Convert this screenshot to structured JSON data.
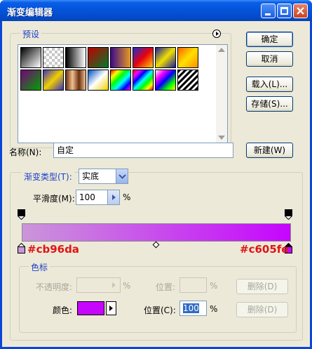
{
  "window": {
    "title": "渐变编辑器"
  },
  "presets": {
    "label": "预设",
    "swatches": [
      "linear-gradient(135deg,#000,#fff)",
      "repeating-conic-gradient(#c8c8c8 0 25%,#fff 0 50%) 0 0/8px 8px",
      "linear-gradient(to right,#000,#fff)",
      "linear-gradient(135deg,#c00000,#007a2a)",
      "linear-gradient(to right,#3b0a8c,#e89a20)",
      "linear-gradient(135deg,#1b2fd0,#e80010,#ffd000)",
      "linear-gradient(135deg,#1a1aa0,#f0e000,#1a1aa0)",
      "linear-gradient(135deg,#ff6000,#ffe000,#ff9000)",
      "linear-gradient(135deg,#7a007a,#00a000)",
      "linear-gradient(135deg,#4030c0,#f0d000,#4030c0)",
      "linear-gradient(to right,#6a3010,#f0c090,#6a3010,#f0c090)",
      "linear-gradient(135deg,#0050c0,#ffffff,#f0d000)",
      "linear-gradient(135deg,#ff0000,#ffff00,#00ff00,#00ffff,#0000ff,#ff00ff)",
      "linear-gradient(135deg,#ff0000,#ff00ff,#0000ff,#00ffff,#00ff00,#ffff00,#ff0000)",
      "linear-gradient(135deg,#ffffff,#ff00ff,#0000ff,#00ff00,#ffff00)",
      "repeating-linear-gradient(135deg,#000 0 3px,#fff 3px 6px)"
    ]
  },
  "buttons": {
    "ok": "确定",
    "cancel": "取消",
    "load": "载入(L)...",
    "save": "存储(S)...",
    "new": "新建(W)"
  },
  "name_field": {
    "label": "名称(N):",
    "value": "自定"
  },
  "gradient": {
    "type_label": "渐变类型(T):",
    "type_value": "实底",
    "smoothness_label": "平滑度(M):",
    "smoothness_value": "100",
    "smoothness_unit": "%",
    "start_color": "#cb96da",
    "end_color": "#c605fe"
  },
  "stops": {
    "label": "色标",
    "opacity_label": "不透明度:",
    "opacity_unit": "%",
    "position_label_top": "位置:",
    "position_unit_top": "%",
    "delete_top": "删除(D)",
    "color_label": "颜色:",
    "color_value": "#c605fe",
    "position_label": "位置(C):",
    "position_value": "100",
    "position_unit": "%",
    "delete_bottom": "删除(D)"
  }
}
